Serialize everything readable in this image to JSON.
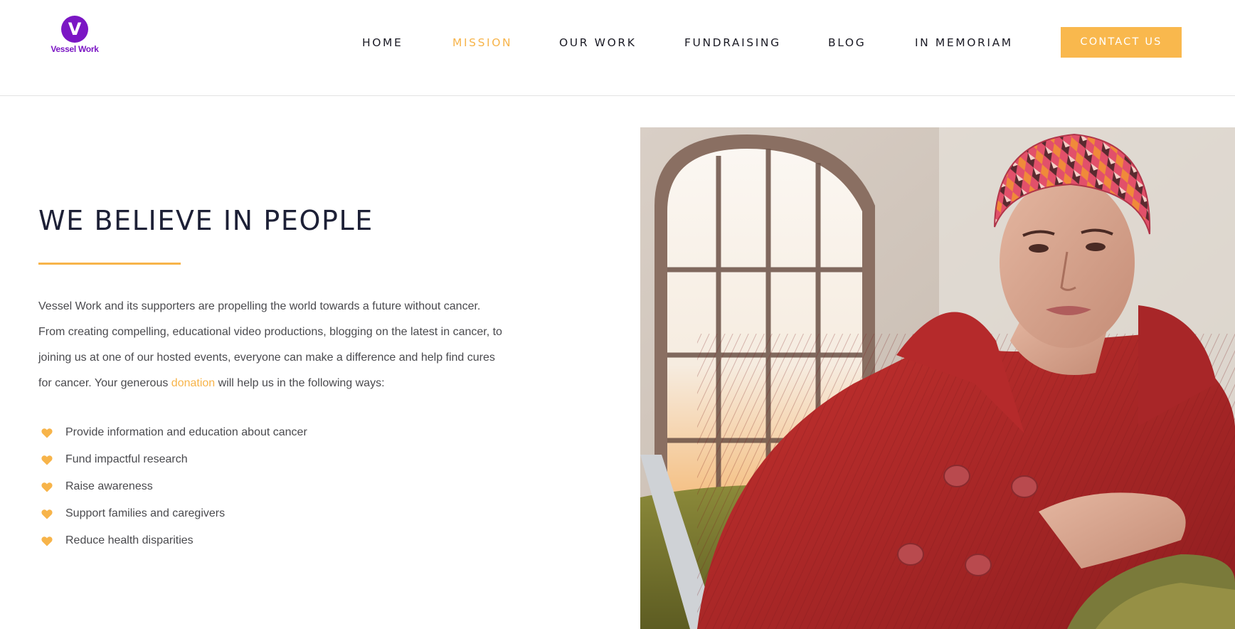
{
  "brand": {
    "logo_letter": "V",
    "logo_text": "Vessel Work",
    "purple": "#7b16c4",
    "accent": "#f7b44a"
  },
  "nav": {
    "items": [
      {
        "label": "HOME",
        "active": false
      },
      {
        "label": "MISSION",
        "active": true
      },
      {
        "label": "OUR WORK",
        "active": false
      },
      {
        "label": "FUNDRAISING",
        "active": false
      },
      {
        "label": "BLOG",
        "active": false
      },
      {
        "label": "IN MEMORIAM",
        "active": false
      }
    ],
    "contact_label": "CONTACT US"
  },
  "main": {
    "heading": "WE BELIEVE IN PEOPLE",
    "intro_lines": [
      "Vessel Work and its supporters are propelling the world towards a future without cancer.",
      "From creating compelling, educational video productions, blogging on the latest in cancer, to",
      "joining us at one of our hosted events, everyone can make a difference and help find cures"
    ],
    "intro_last_before": "for cancer.  Your generous ",
    "intro_link": "donation",
    "intro_last_after": " will help us in the following ways:",
    "bullets": [
      "Provide information and education about cancer",
      "Fund impactful research",
      "Raise awareness",
      "Support families and caregivers",
      "Reduce health disparities"
    ],
    "bullet_icon": "heart-icon"
  }
}
